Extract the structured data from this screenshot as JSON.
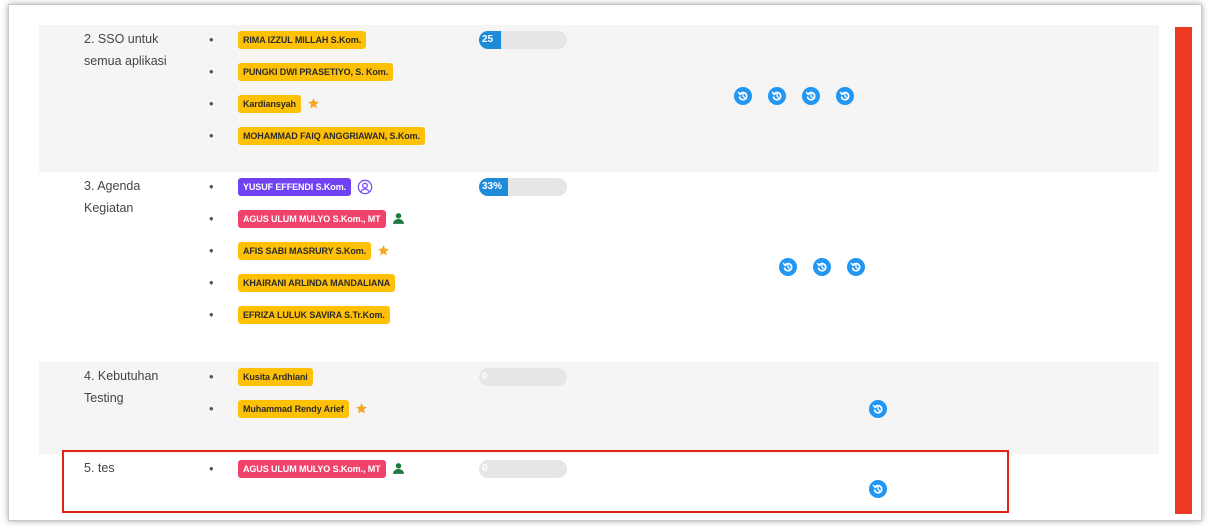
{
  "colors": {
    "accent": "#2196f3",
    "yellow_badge": "#ffc107",
    "purple_badge": "#6f42f5",
    "pink_badge": "#f0426b",
    "star": "#f5a623",
    "person": "#1f7a3e",
    "highlight": "#e2231a",
    "scrollbar": "#ee3a24"
  },
  "rows": [
    {
      "task": "2. SSO untuk semua aplikasi",
      "progress_label": "25",
      "progress_percent": 25,
      "members": [
        {
          "name": "RIMA IZZUL MILLAH S.Kom.",
          "color": "yellow",
          "role_icon": ""
        },
        {
          "name": "PUNGKI DWI PRASETIYO, S. Kom.",
          "color": "yellow",
          "role_icon": ""
        },
        {
          "name": "Kardiansyah",
          "color": "yellow",
          "role_icon": "star-icon"
        },
        {
          "name": "MOHAMMAD FAIQ ANGGRIAWAN, S.Kom.",
          "color": "yellow",
          "role_icon": ""
        }
      ],
      "history_buttons": 4
    },
    {
      "task": "3. Agenda Kegiatan",
      "progress_label": "33%",
      "progress_percent": 33,
      "members": [
        {
          "name": "YUSUF EFFENDI S.Kom.",
          "color": "purple",
          "role_icon": "user-circle-icon"
        },
        {
          "name": "AGUS ULUM MULYO S.Kom., MT",
          "color": "pink",
          "role_icon": "person-icon"
        },
        {
          "name": "AFIS SABI MASRURY S.Kom.",
          "color": "yellow",
          "role_icon": "star-icon"
        },
        {
          "name": "KHAIRANI ARLINDA MANDALIANA",
          "color": "yellow",
          "role_icon": ""
        },
        {
          "name": "EFRIZA LULUK SAVIRA S.Tr.Kom.",
          "color": "yellow",
          "role_icon": ""
        }
      ],
      "history_buttons": 3
    },
    {
      "task": "4. Kebutuhan Testing",
      "progress_label": "0",
      "progress_percent": 0,
      "members": [
        {
          "name": "Kusita Ardhiani",
          "color": "yellow",
          "role_icon": ""
        },
        {
          "name": "Muhammad Rendy Arief",
          "color": "yellow",
          "role_icon": "star-icon"
        }
      ],
      "history_buttons": 1
    },
    {
      "task": "5. tes",
      "progress_label": "0",
      "progress_percent": 0,
      "members": [
        {
          "name": "AGUS ULUM MULYO S.Kom., MT",
          "color": "pink",
          "role_icon": "person-icon"
        }
      ],
      "history_buttons": 1
    }
  ]
}
